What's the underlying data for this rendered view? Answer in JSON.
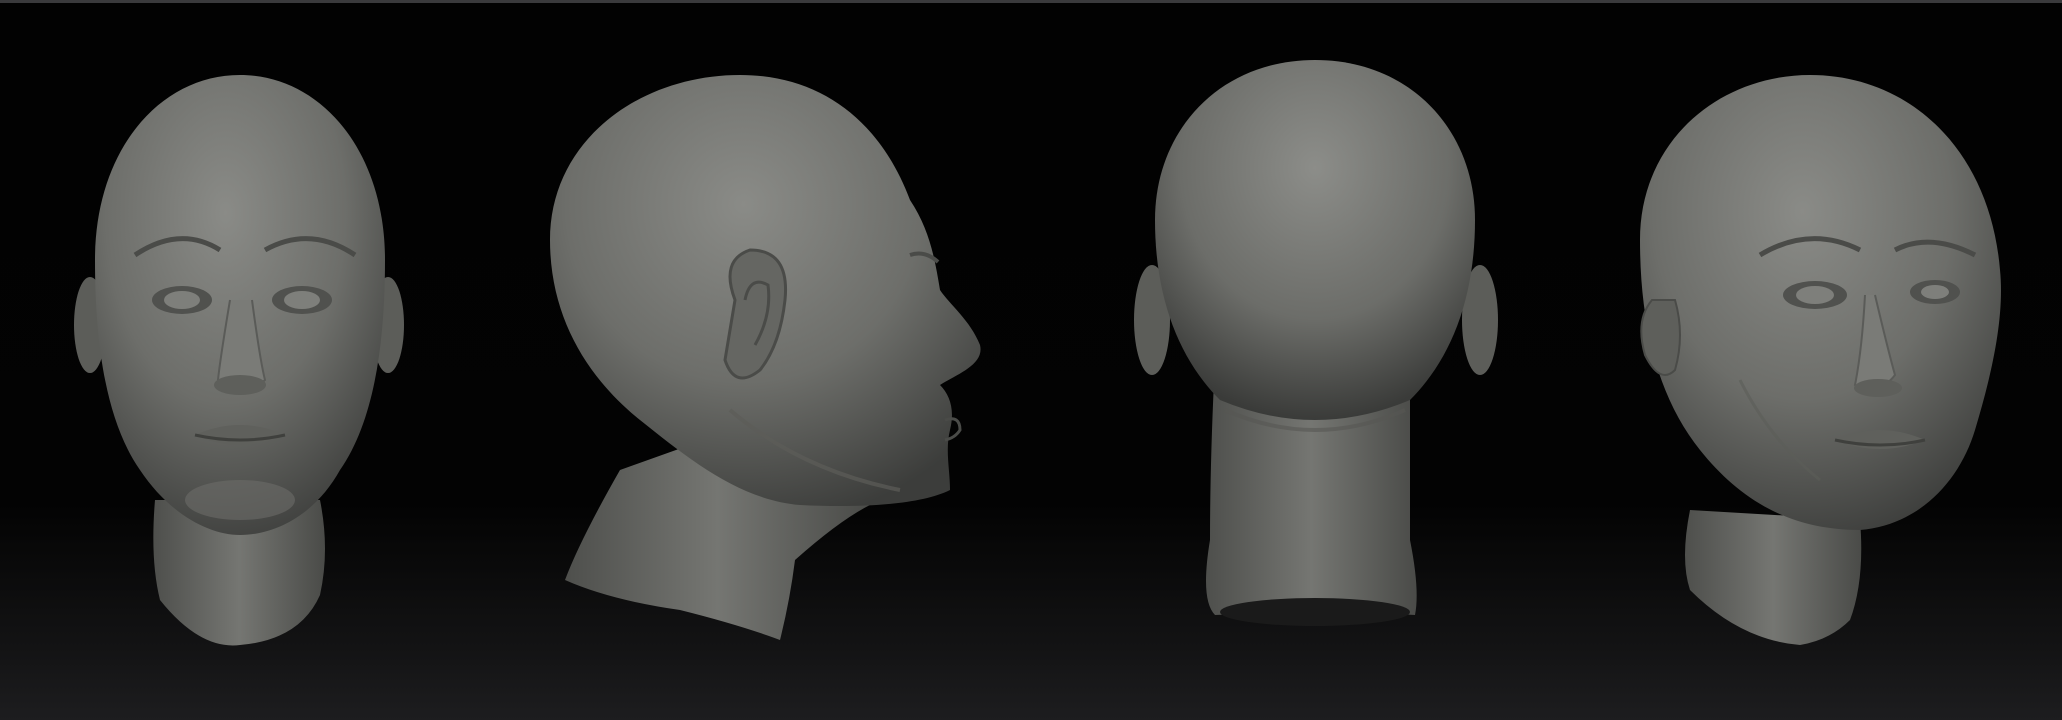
{
  "viewport": {
    "background_top": "#020202",
    "background_bottom": "#1d1d1f",
    "top_border": "#3a3a3c"
  },
  "sculpt": {
    "material_color": "#6f706c",
    "views": [
      {
        "name": "front",
        "description": ""
      },
      {
        "name": "right-profile",
        "description": ""
      },
      {
        "name": "back",
        "description": ""
      },
      {
        "name": "three-quarter",
        "description": ""
      }
    ]
  }
}
